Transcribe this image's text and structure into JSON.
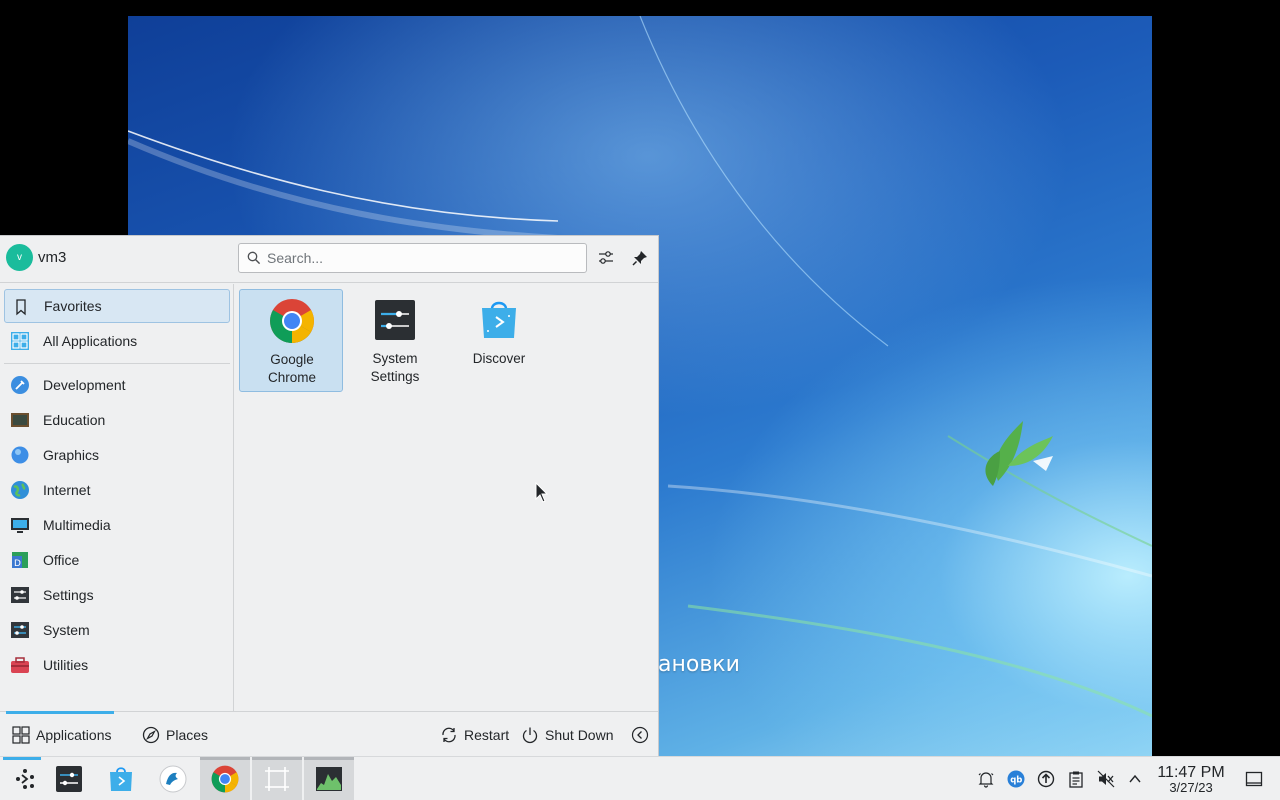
{
  "desktop": {
    "wallpaper_text": "ановки"
  },
  "launcher": {
    "user": {
      "initial": "v",
      "name": "vm3"
    },
    "search": {
      "placeholder": "Search...",
      "value": ""
    },
    "header_buttons": {
      "configure": "configure-icon",
      "pin": "pin-icon"
    },
    "sidebar": {
      "top_items": [
        {
          "label": "Favorites",
          "icon": "bookmark-icon",
          "active": true
        },
        {
          "label": "All Applications",
          "icon": "grid-icon",
          "active": false
        }
      ],
      "categories": [
        {
          "label": "Development",
          "icon": "development-icon"
        },
        {
          "label": "Education",
          "icon": "education-icon"
        },
        {
          "label": "Graphics",
          "icon": "graphics-icon"
        },
        {
          "label": "Internet",
          "icon": "internet-icon"
        },
        {
          "label": "Multimedia",
          "icon": "multimedia-icon"
        },
        {
          "label": "Office",
          "icon": "office-icon"
        },
        {
          "label": "Settings",
          "icon": "settings-icon"
        },
        {
          "label": "System",
          "icon": "system-icon"
        },
        {
          "label": "Utilities",
          "icon": "utilities-icon"
        }
      ]
    },
    "favorites": [
      {
        "line1": "Google",
        "line2": "Chrome",
        "icon": "chrome-icon",
        "selected": true
      },
      {
        "line1": "System",
        "line2": "Settings",
        "icon": "system-settings-icon",
        "selected": false
      },
      {
        "line1": "Discover",
        "line2": "",
        "icon": "discover-icon",
        "selected": false
      }
    ],
    "footer": {
      "applications": "Applications",
      "places": "Places",
      "restart": "Restart",
      "shutdown": "Shut Down"
    }
  },
  "taskbar": {
    "apps": [
      "application-launcher-icon",
      "system-settings-icon",
      "discover-icon",
      "dolphin-icon",
      "chrome-icon",
      "spectacle-icon",
      "system-monitor-icon"
    ],
    "tray": [
      "notifications-icon",
      "qbittorrent-icon",
      "updates-icon",
      "clipboard-icon",
      "volume-muted-icon",
      "expand-tray-icon"
    ],
    "clock": {
      "time": "11:47 PM",
      "date": "3/27/23"
    }
  },
  "colors": {
    "accent": "#3daee9",
    "panel_bg": "#eff0f1",
    "selected_bg": "#c9e0f1",
    "text": "#232629"
  }
}
